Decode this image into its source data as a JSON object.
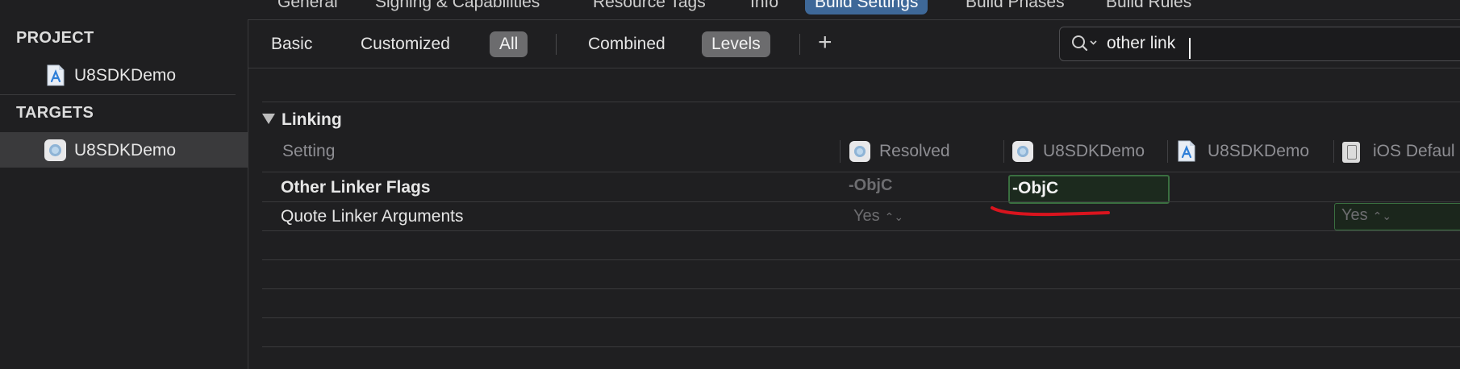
{
  "top_tabs": [
    "General",
    "Signing & Capabilities",
    "Resource Tags",
    "Info",
    "Build Settings",
    "Build Phases",
    "Build Rules"
  ],
  "active_tab": "Build Settings",
  "sidebar": {
    "project_header": "PROJECT",
    "project_item": "U8SDKDemo",
    "targets_header": "TARGETS",
    "target_item": "U8SDKDemo"
  },
  "filters": {
    "basic": "Basic",
    "customized": "Customized",
    "all": "All",
    "combined": "Combined",
    "levels": "Levels",
    "selected_scope": "All",
    "selected_view": "Levels"
  },
  "search": {
    "value": "other link"
  },
  "section": {
    "title": "Linking"
  },
  "columns": {
    "setting": "Setting",
    "resolved": "Resolved",
    "target": "U8SDKDemo",
    "project": "U8SDKDemo",
    "ios_default": "iOS Defaul"
  },
  "rows": [
    {
      "name": "Other Linker Flags",
      "resolved": "-ObjC",
      "target_value": "-ObjC"
    },
    {
      "name": "Quote Linker Arguments",
      "resolved": "Yes",
      "ios_default": "Yes"
    }
  ],
  "colors": {
    "background": "#1f1f21",
    "active_tab": "#3e6898",
    "selected_filter": "#6c6c6e",
    "edit_border": "#3a6f40",
    "annotation": "#d9141e"
  }
}
